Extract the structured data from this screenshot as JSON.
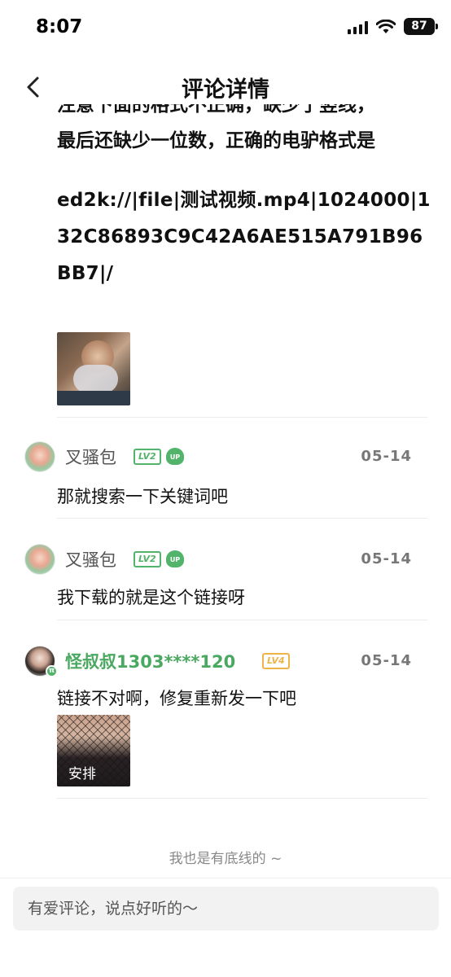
{
  "status_bar": {
    "time": "8:07",
    "battery": "87"
  },
  "nav": {
    "title": "评论详情"
  },
  "post": {
    "partial_line": "注意下面的格式不正确，缺少了竖线，",
    "line1": "最后还缺少一位数，正确的电驴格式是",
    "link": "ed2k://|file|测试视频.mp4|1024000|132C86893C9C42A6AE515A791B96BB7|/"
  },
  "comments": [
    {
      "user": "叉骚包",
      "level": "LV2",
      "up": "UP",
      "date": "05-14",
      "text": "那就搜索一下关键词吧"
    },
    {
      "user": "叉骚包",
      "level": "LV2",
      "up": "UP",
      "date": "05-14",
      "text": "我下载的就是这个链接呀"
    },
    {
      "user": "怪叔叔1303****120",
      "level": "LV4",
      "badge": "π",
      "date": "05-14",
      "text": "链接不对啊，修复重新发一下吧",
      "image_caption": "安排"
    }
  ],
  "footer_note": "我也是有底线的 ~",
  "input": {
    "placeholder": "有爱评论，说点好听的～"
  },
  "colors": {
    "accent_green": "#52b36a",
    "level_gold": "#efb447"
  }
}
